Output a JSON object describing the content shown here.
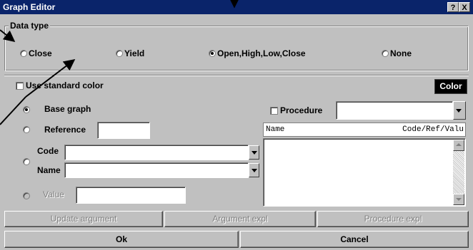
{
  "window": {
    "title": "Graph Editor",
    "help_label": "?",
    "close_label": "X"
  },
  "data_type": {
    "legend": "Data type",
    "options": [
      {
        "label": "Close",
        "selected": false
      },
      {
        "label": "Yield",
        "selected": false
      },
      {
        "label": "Open,High,Low,Close",
        "selected": true
      },
      {
        "label": "None",
        "selected": false
      }
    ]
  },
  "use_standard_color": {
    "label": "Use standard color",
    "checked": false
  },
  "color_button": {
    "label": "Color"
  },
  "graph_source": {
    "base_graph": {
      "label": "Base graph",
      "selected": true
    },
    "reference": {
      "label": "Reference",
      "value": ""
    },
    "code": {
      "label": "Code",
      "value": ""
    },
    "name": {
      "label": "Name",
      "value": ""
    },
    "value": {
      "label": "Value",
      "value": ""
    }
  },
  "procedure": {
    "label": "Procedure",
    "checked": false,
    "value": ""
  },
  "list": {
    "col_name": "Name",
    "col_code": "Code/Ref/Valu"
  },
  "action_buttons": {
    "update_argument": "Update argument",
    "argument_expl": "Argument expl",
    "procedure_expl": "Procedure expl"
  },
  "footer": {
    "ok": "Ok",
    "cancel": "Cancel"
  }
}
